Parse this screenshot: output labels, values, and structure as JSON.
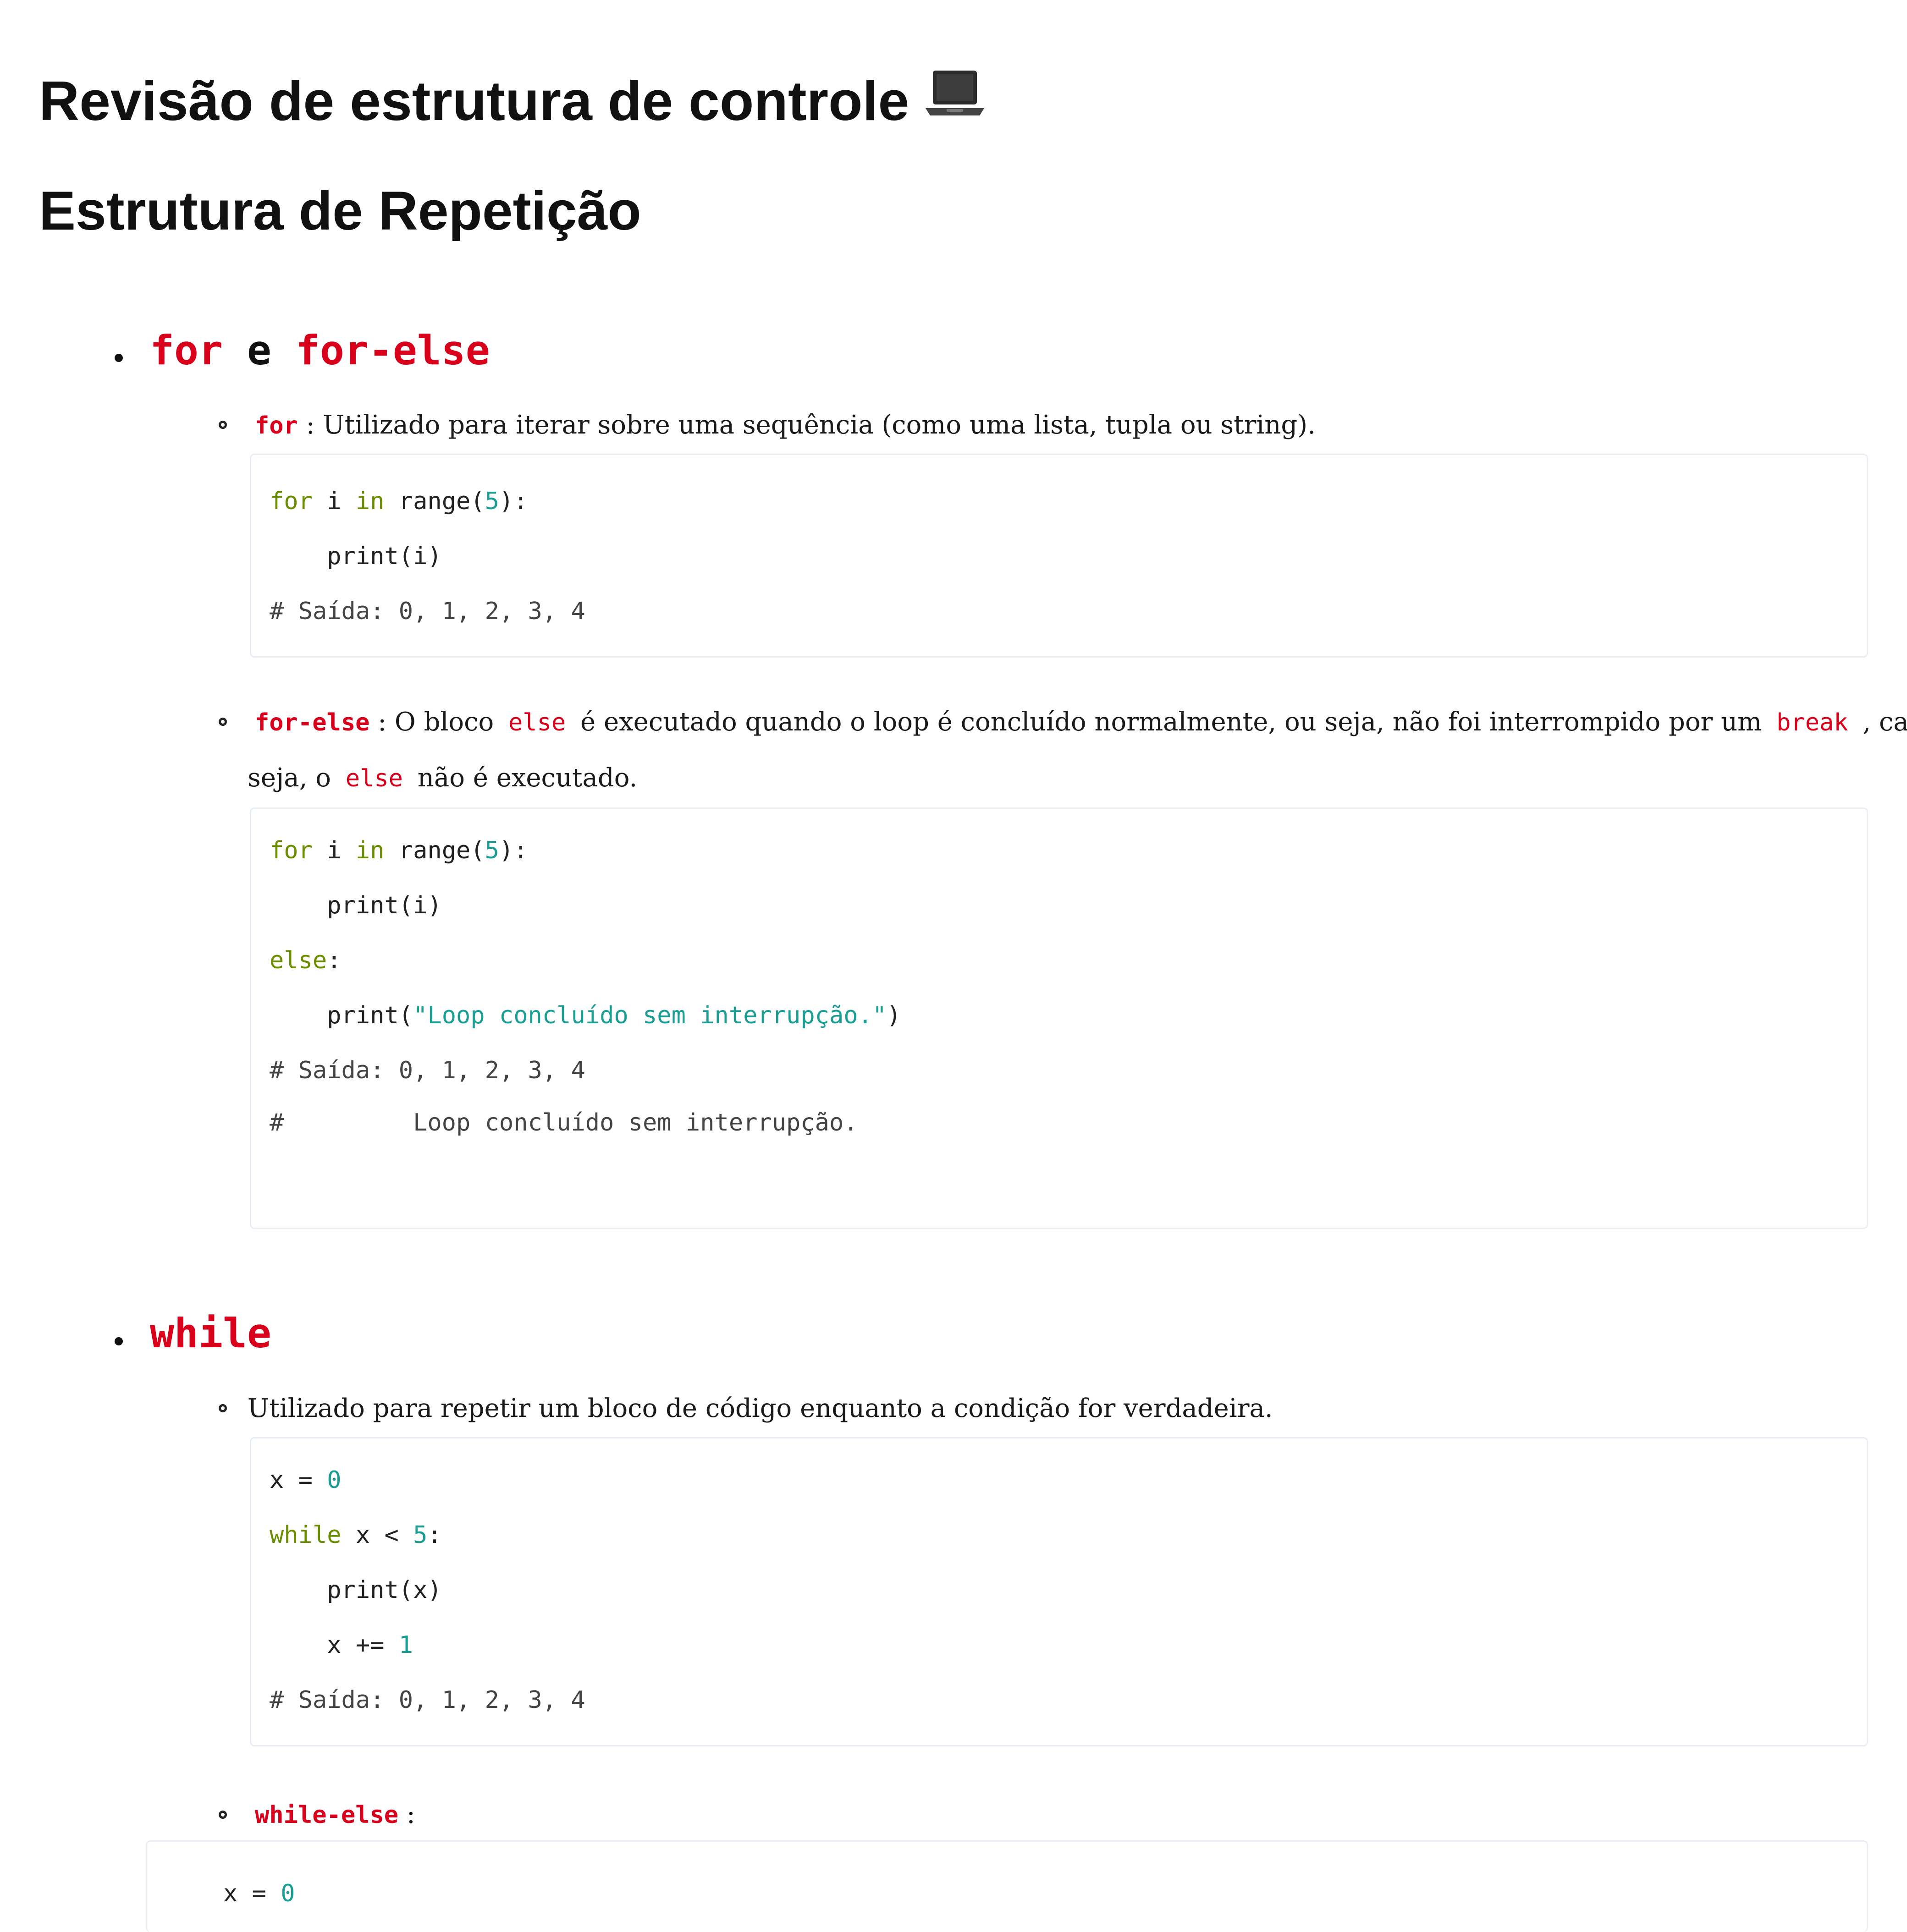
{
  "title": "Revisão de estrutura de controle",
  "subtitle": "Estrutura de Repetição",
  "icon": "laptop-icon",
  "section_for": {
    "kw1": "for",
    "sep": " e ",
    "kw2": "for-else",
    "item1": {
      "kw": "for",
      "text": " : Utilizado para iterar sobre uma sequência (como uma lista, tupla ou string)."
    },
    "code1": {
      "l1_kw": "for",
      "l1_a": " i ",
      "l1_in": "in",
      "l1_b": " range(",
      "l1_num": "5",
      "l1_c": "):",
      "l2": "    print(i)",
      "l3": "# Saída: 0, 1, 2, 3, 4"
    },
    "item2": {
      "kw": "for-else",
      "t1": " : O bloco ",
      "c1": "else",
      "t2": " é executado quando o loop é concluído normalmente, ou seja, não foi interrompido por um ",
      "c2": "break",
      "t3": " , caso",
      "t4": "seja, o ",
      "c3": "else",
      "t5": " não é executado."
    },
    "code2": {
      "l1_kw": "for",
      "l1_a": " i ",
      "l1_in": "in",
      "l1_b": " range(",
      "l1_num": "5",
      "l1_c": "):",
      "l2": "    print(i)",
      "l3_kw": "else",
      "l3_b": ":",
      "l4_a": "    print(",
      "l4_str": "\"Loop concluído sem interrupção.\"",
      "l4_b": ")",
      "l5": "# Saída: 0, 1, 2, 3, 4",
      "l6": "#         Loop concluído sem interrupção."
    }
  },
  "section_while": {
    "kw": "while",
    "item1": {
      "text": "Utilizado para repetir um bloco de código enquanto a condição for verdadeira."
    },
    "code1": {
      "l1_a": "x = ",
      "l1_num": "0",
      "l2_kw": "while",
      "l2_a": " x < ",
      "l2_num": "5",
      "l2_b": ":",
      "l3": "    print(x)",
      "l4_a": "    x += ",
      "l4_num": "1",
      "l5": "# Saída: 0, 1, 2, 3, 4"
    },
    "item2": {
      "kw": "while-else",
      "text": " :"
    },
    "code2": {
      "l1_a": "x = ",
      "l1_num": "0"
    }
  }
}
